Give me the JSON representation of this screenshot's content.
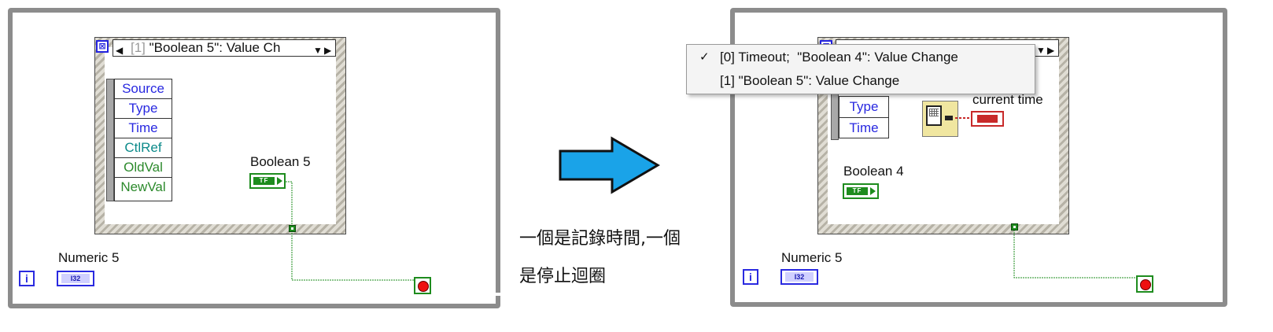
{
  "left_panel": {
    "event_case_selector": "\"Boolean 5\": Value Ch",
    "event_case_index": "[1]",
    "event_data_items": [
      {
        "label": "Source",
        "color": "#2828e0"
      },
      {
        "label": "Type",
        "color": "#2828e0"
      },
      {
        "label": "Time",
        "color": "#2828e0"
      },
      {
        "label": "CtlRef",
        "color": "#0c8a8a"
      },
      {
        "label": "OldVal",
        "color": "#2c8a2c"
      },
      {
        "label": "NewVal",
        "color": "#2c8a2c"
      }
    ],
    "boolean_label": "Boolean 5",
    "numeric_label": "Numeric 5",
    "iteration_terminal": "i",
    "numeric_type": "I32",
    "boolean_type": "TF"
  },
  "caption": {
    "line1": "一個是記錄時間,一個",
    "line2": "是停止迴圈"
  },
  "right_panel": {
    "menu_items": [
      {
        "index": "[0]",
        "label": "Timeout;  \"Boolean 4\": Value Change",
        "checked": true
      },
      {
        "index": "[1]",
        "label": "\"Boolean 5\": Value Change",
        "checked": false
      }
    ],
    "check_mark": "✓",
    "event_data_items": [
      {
        "label": "Type",
        "color": "#2828e0"
      },
      {
        "label": "Time",
        "color": "#2828e0"
      }
    ],
    "current_time_label": "current time",
    "boolean_label": "Boolean 4",
    "numeric_label": "Numeric 5",
    "iteration_terminal": "i",
    "numeric_type": "I32",
    "boolean_type": "TF"
  },
  "colors": {
    "arrow_fill": "#1aa3e8",
    "wire_green": "#1e8c1e",
    "frame_gray": "#8c8c8c"
  }
}
